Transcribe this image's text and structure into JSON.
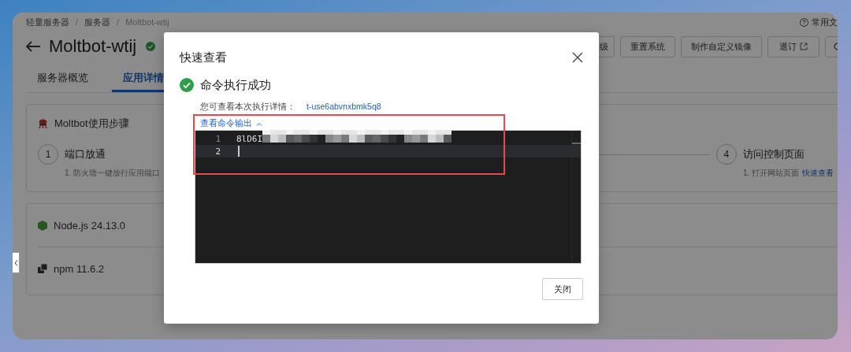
{
  "breadcrumb": [
    {
      "label": "轻量服务器"
    },
    {
      "separator": "/",
      "label": "服务器"
    },
    {
      "separator": "/",
      "label": "Moltbot-wtij"
    }
  ],
  "help_link": "常用文",
  "header": {
    "title": "Moltbot-wtij",
    "status": {
      "kind": "running"
    },
    "buttons": [
      {
        "kind": "text",
        "label": "级"
      },
      {
        "kind": "text",
        "label": "重置系统"
      },
      {
        "kind": "text",
        "label": "制作自定义镜像"
      },
      {
        "kind": "external",
        "label": "退订"
      },
      {
        "kind": "refresh"
      }
    ]
  },
  "tabs": [
    {
      "label": "服务器概览",
      "selected": false
    },
    {
      "label": "应用详情",
      "selected": true
    }
  ],
  "steps_card": {
    "title": "Moltbot使用步骤",
    "steps": [
      {
        "number": "1",
        "title": "端口放通",
        "description": "1. 防火墙一键放行应用端口"
      },
      {
        "number": "4",
        "title": "访问控制页面",
        "description": "1. 打开网站页面",
        "link": "快速查看"
      }
    ]
  },
  "packages": [
    {
      "kind": "node",
      "name": "Node.js 24.13.0"
    },
    {
      "kind": "npm",
      "name": "npm 11.6.2"
    }
  ],
  "dialog": {
    "title": "快速查看",
    "result": {
      "kind": "success",
      "text": "命令执行成功"
    },
    "detail_label": "您可查看本次执行详情：",
    "detail_link": "t-use6abvnxbmk5q8",
    "output_toggle": {
      "label": "查看命令输出",
      "expanded": true
    },
    "output_lines": [
      {
        "number": "1",
        "text": "8lD6I",
        "redacted": true,
        "current": false
      },
      {
        "number": "2",
        "redacted": false,
        "current": true
      }
    ],
    "buttons": [
      "关闭"
    ]
  }
}
